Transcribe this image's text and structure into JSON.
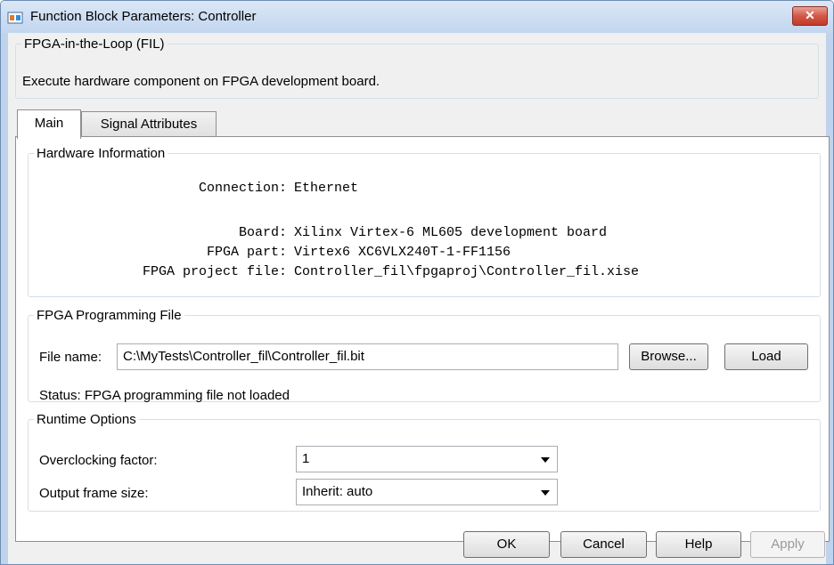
{
  "window": {
    "title": "Function Block Parameters: Controller",
    "close_label": "✕"
  },
  "intro": {
    "heading": "FPGA-in-the-Loop (FIL)",
    "description": "Execute hardware component on FPGA development board."
  },
  "tabs": [
    {
      "label": "Main",
      "active": true
    },
    {
      "label": "Signal Attributes",
      "active": false
    }
  ],
  "hardware": {
    "heading": "Hardware Information",
    "rows": [
      {
        "label": "Connection:",
        "value": "Ethernet"
      },
      {
        "label": "Board:",
        "value": "Xilinx Virtex-6 ML605 development board"
      },
      {
        "label": "FPGA part:",
        "value": "Virtex6 XC6VLX240T-1-FF1156"
      },
      {
        "label": "FPGA project file:",
        "value": "Controller_fil\\fpgaproj\\Controller_fil.xise"
      }
    ]
  },
  "programming": {
    "heading": "FPGA Programming File",
    "file_label": "File name:",
    "file_value": "C:\\MyTests\\Controller_fil\\Controller_fil.bit",
    "browse_label": "Browse...",
    "load_label": "Load",
    "status": "Status: FPGA programming file not loaded"
  },
  "runtime": {
    "heading": "Runtime Options",
    "overclock_label": "Overclocking factor:",
    "overclock_value": "1",
    "frame_label": "Output frame size:",
    "frame_value": "Inherit: auto"
  },
  "buttons": {
    "ok": "OK",
    "cancel": "Cancel",
    "help": "Help",
    "apply": "Apply"
  },
  "colors": {
    "title_bar": "#c2d6ef",
    "close_button": "#d25845",
    "panel_background": "#ffffff",
    "dialog_background": "#f0f0f0"
  }
}
